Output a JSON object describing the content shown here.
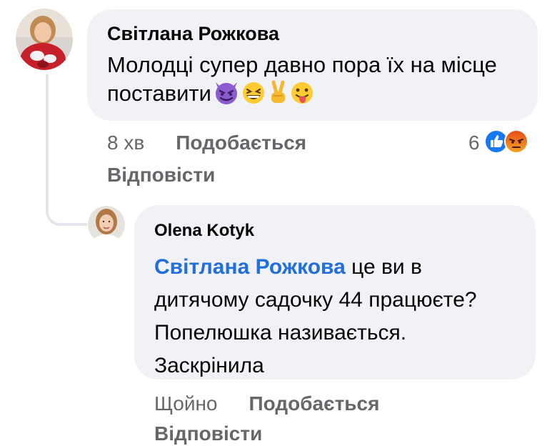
{
  "comment": {
    "author": "Світлана Рожкова",
    "text": "Молодці супер давно пора їх на місце поставити",
    "emojis": [
      "smiling-imp",
      "grinning-squinting",
      "victory-hand",
      "tongue-out"
    ],
    "time": "8 хв",
    "like_label": "Подобається",
    "reply_label": "Відповісти",
    "reaction_count": "6",
    "reactions": [
      "like",
      "angry"
    ]
  },
  "reply": {
    "author": "Olena Kotyk",
    "mention": "Світлана Рожкова",
    "text": " це ви в дитячому садочку 44 працюєте? Попелюшка називається. Заскрінила",
    "time": "Щойно",
    "like_label": "Подобається",
    "reply_label": "Відповісти"
  },
  "colors": {
    "bubble": "#f0f2f5",
    "mention": "#216fdb",
    "meta": "#65676b",
    "like_blue": "#1877f2",
    "angry": "#e9710f"
  }
}
